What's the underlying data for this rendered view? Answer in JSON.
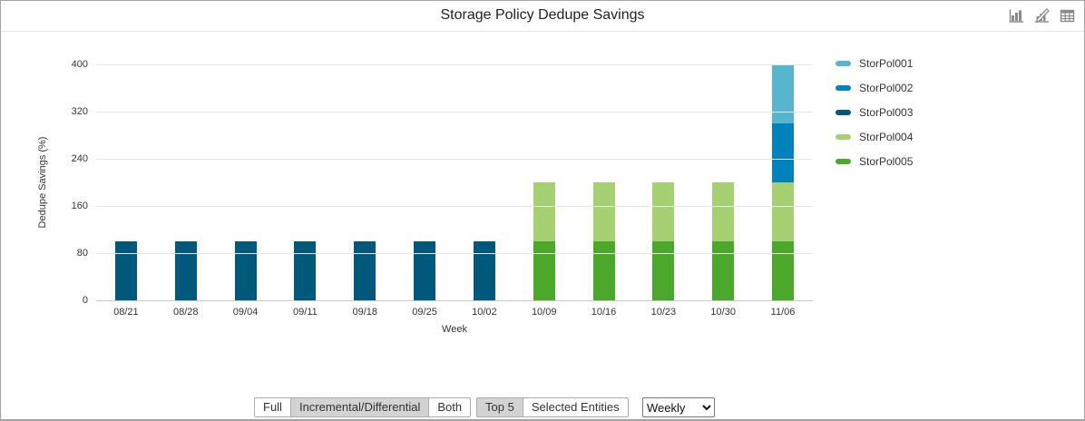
{
  "widget": {
    "title": "Storage Policy Dedupe Savings"
  },
  "toolbar": {
    "icons": [
      "column-chart",
      "edit-chart",
      "table-view"
    ]
  },
  "chart_data": {
    "type": "bar",
    "stacked": true,
    "title": "Storage Policy Dedupe Savings",
    "xlabel": "Week",
    "ylabel": "Dedupe Savings  (%)",
    "ylim": [
      0,
      400
    ],
    "yticks": [
      0,
      80,
      160,
      240,
      320,
      400
    ],
    "grid": "horizontal",
    "legend_position": "right",
    "categories": [
      "08/21",
      "08/28",
      "09/04",
      "09/11",
      "09/18",
      "09/25",
      "10/02",
      "10/09",
      "10/16",
      "10/23",
      "10/30",
      "11/06"
    ],
    "series": [
      {
        "name": "StorPol001",
        "color": "#57b5cd",
        "values": [
          0,
          0,
          0,
          0,
          0,
          0,
          0,
          0,
          0,
          0,
          0,
          100
        ]
      },
      {
        "name": "StorPol002",
        "color": "#0082bd",
        "values": [
          0,
          0,
          0,
          0,
          0,
          0,
          0,
          0,
          0,
          0,
          0,
          100
        ]
      },
      {
        "name": "StorPol003",
        "color": "#00587b",
        "values": [
          100,
          100,
          100,
          100,
          100,
          100,
          100,
          0,
          0,
          0,
          0,
          0
        ]
      },
      {
        "name": "StorPol004",
        "color": "#a5d173",
        "values": [
          0,
          0,
          0,
          0,
          0,
          0,
          0,
          100,
          100,
          100,
          100,
          100
        ]
      },
      {
        "name": "StorPol005",
        "color": "#4ca82b",
        "values": [
          0,
          0,
          0,
          0,
          0,
          0,
          0,
          100,
          100,
          100,
          100,
          100
        ]
      }
    ]
  },
  "controls": {
    "backup_type_group": [
      {
        "label": "Full",
        "selected": false
      },
      {
        "label": "Incremental/Differential",
        "selected": true
      },
      {
        "label": "Both",
        "selected": false
      }
    ],
    "entity_group": [
      {
        "label": "Top 5",
        "selected": true
      },
      {
        "label": "Selected Entities",
        "selected": false
      }
    ],
    "frequency_select": {
      "value": "Weekly",
      "options": [
        "Weekly"
      ]
    }
  }
}
